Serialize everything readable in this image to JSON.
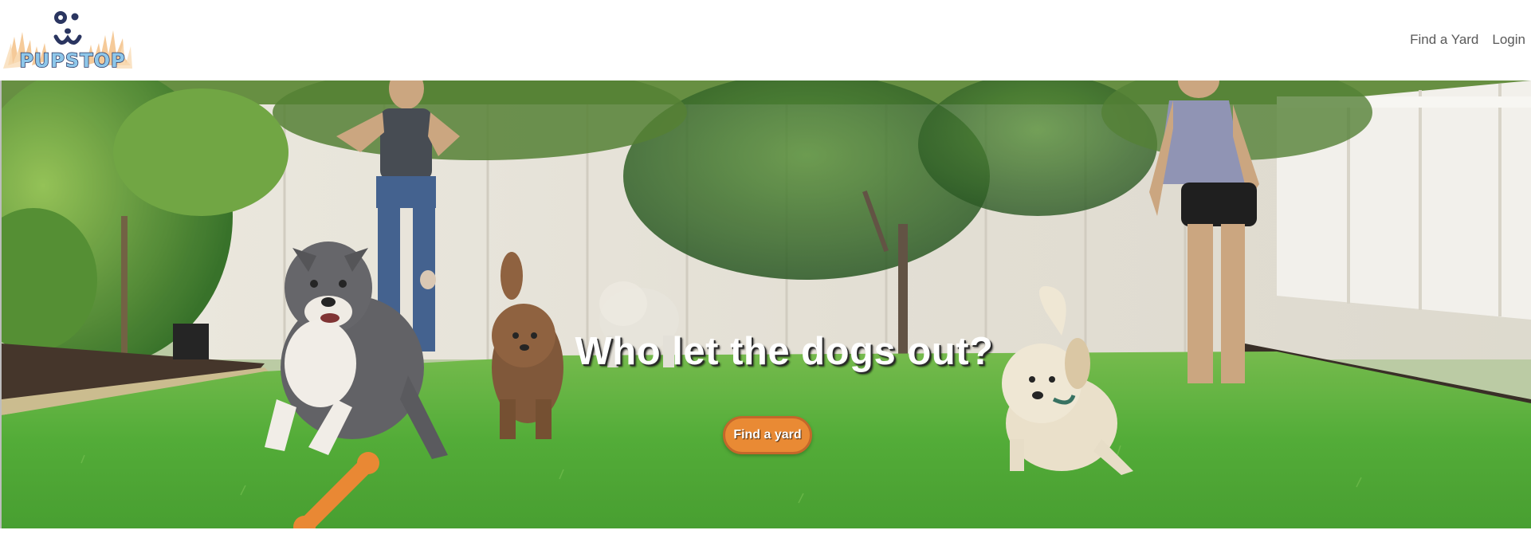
{
  "header": {
    "logo_text": "PUPSTOP",
    "nav": [
      {
        "label": "Find a Yard"
      },
      {
        "label": "Login"
      }
    ]
  },
  "hero": {
    "title": "Who let the dogs out?",
    "button_label": "Find a yard"
  },
  "colors": {
    "accent": "#e98a34",
    "nav_text": "#595959",
    "logo_fill": "#8ec7ea"
  },
  "icons": [
    "dog-face-icon",
    "grass-icon"
  ]
}
